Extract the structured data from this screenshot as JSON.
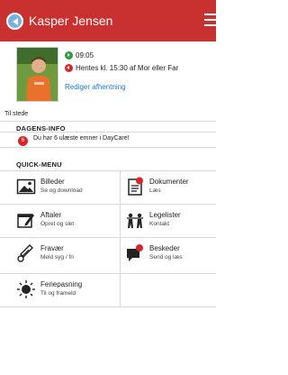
{
  "header": {
    "title": "Kasper Jensen",
    "back_icon": "back-circle-icon",
    "menu_icon": "hamburger-menu-icon",
    "color": "#c8312f"
  },
  "child": {
    "status_rows": [
      {
        "icon": "arrival-green-icon",
        "text": "09:05"
      },
      {
        "icon": "pickup-red-icon",
        "text": "Hentes kl. 15:30 af Mor eller Far"
      }
    ],
    "edit_pickup_link": "Rediger afhentning",
    "presence": "Til stede"
  },
  "daily_info": {
    "title": "DAGENS-INFO",
    "badge": "6",
    "message": "Du har 6 ulæste emner i DayCare!"
  },
  "quick_menu": {
    "title": "QUICK-MENU",
    "items": [
      {
        "label": "Billeder",
        "sub": "Se og download",
        "icon": "photo-icon"
      },
      {
        "label": "Dokumenter",
        "sub": "Læs",
        "icon": "document-icon",
        "badge": "2"
      },
      {
        "label": "Aftaler",
        "sub": "Opret og slet",
        "icon": "calendar-edit-icon"
      },
      {
        "label": "Legelister",
        "sub": "Kontakt",
        "icon": "children-playing-icon"
      },
      {
        "label": "Fravær",
        "sub": "Meld syg / fri",
        "icon": "thermometer-icon"
      },
      {
        "label": "Beskeder",
        "sub": "Send og læs",
        "icon": "messages-icon",
        "badge": "1"
      },
      {
        "label": "Feriepasning",
        "sub": "Til og frameld",
        "icon": "sun-icon"
      }
    ]
  }
}
